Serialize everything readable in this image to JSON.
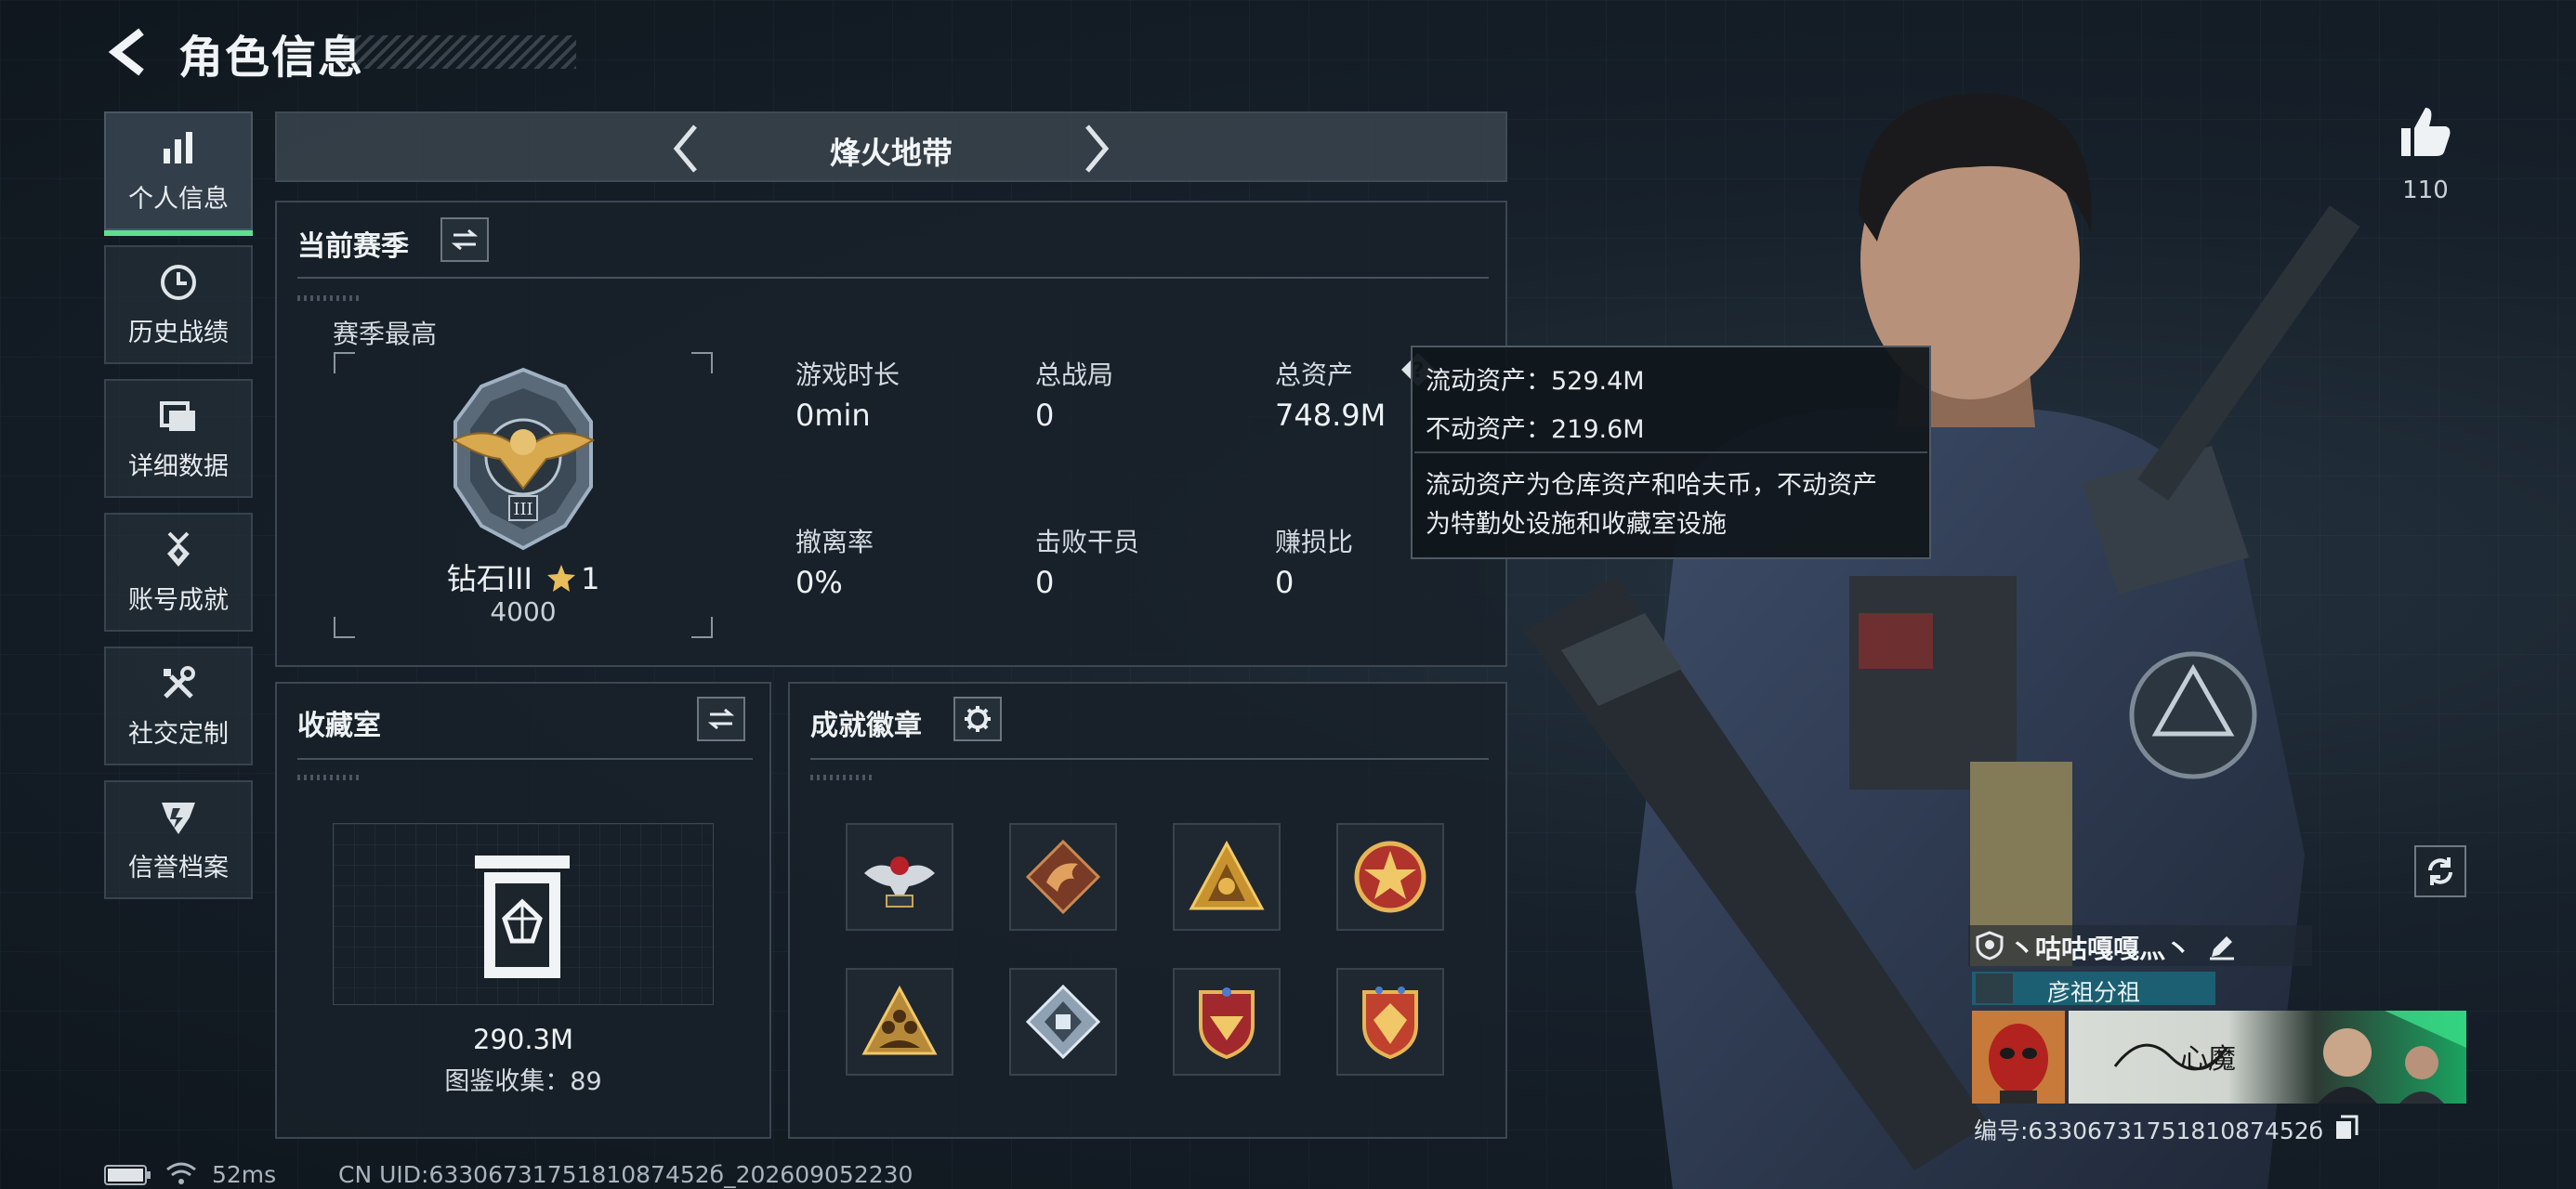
{
  "header": {
    "title": "角色信息"
  },
  "nav": {
    "items": [
      {
        "label": "个人信息",
        "icon": "bar-chart-icon",
        "active": true
      },
      {
        "label": "历史战绩",
        "icon": "clock-icon"
      },
      {
        "label": "详细数据",
        "icon": "folder-icon"
      },
      {
        "label": "账号成就",
        "icon": "medal-icon"
      },
      {
        "label": "社交定制",
        "icon": "tools-icon"
      },
      {
        "label": "信誉档案",
        "icon": "shield-badge-icon"
      }
    ]
  },
  "mode_bar": {
    "title": "烽火地带"
  },
  "season": {
    "title": "当前赛季",
    "best_label": "赛季最高",
    "rank_name": "钻石III",
    "rank_stars": "1",
    "rank_score": "4000",
    "stats": [
      {
        "label": "游戏时长",
        "value": "0min"
      },
      {
        "label": "总战局",
        "value": "0"
      },
      {
        "label": "总资产",
        "value": "748.9M"
      },
      {
        "label": "撤离率",
        "value": "0%"
      },
      {
        "label": "击败干员",
        "value": "0"
      },
      {
        "label": "赚损比",
        "value": "0"
      }
    ]
  },
  "tooltip": {
    "liquid": "流动资产：529.4M",
    "fixed": "不动资产：219.6M",
    "desc_line1": "流动资产为仓库资产和哈夫币，不动资产",
    "desc_line2": "为特勤处设施和收藏室设施"
  },
  "collection": {
    "title": "收藏室",
    "value": "290.3M",
    "catalog": "图鉴收集：89"
  },
  "badges": {
    "title": "成就徽章",
    "items": [
      {
        "icon": "eagle-badge-icon"
      },
      {
        "icon": "dragon-badge-icon"
      },
      {
        "icon": "triangle-hand-badge-icon"
      },
      {
        "icon": "star-shield-badge-icon"
      },
      {
        "icon": "triangle-squad-badge-icon"
      },
      {
        "icon": "diamond-badge-icon"
      },
      {
        "icon": "wing-shield-badge-icon"
      },
      {
        "icon": "crest-shield-badge-icon"
      }
    ]
  },
  "likes": {
    "count": "110"
  },
  "player": {
    "name": "丶咕咕嘎嘎灬丶",
    "tag": "彦祖分祖",
    "id_label": "编号:6330673175181087452б",
    "signature_text": "心魔"
  },
  "footer": {
    "ping": "52ms",
    "uid": "CN UID:6330673175181087452б_202609052230"
  },
  "colors": {
    "accent_green": "#5fe08e",
    "gold": "#d4a547",
    "tag_teal": "#1d5f72"
  }
}
